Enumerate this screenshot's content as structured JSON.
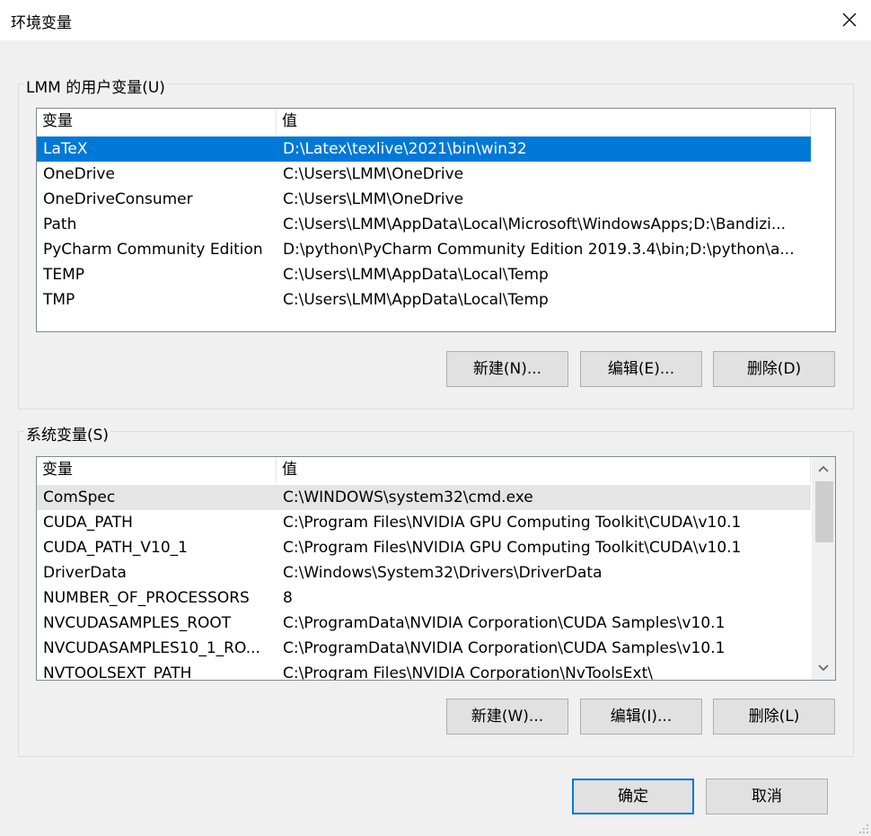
{
  "window": {
    "title": "环境变量"
  },
  "user_vars": {
    "group_label": "LMM 的用户变量(U)",
    "col_var": "变量",
    "col_val": "值",
    "rows": [
      {
        "name": "LaTeX",
        "value": "D:\\Latex\\texlive\\2021\\bin\\win32",
        "selected": true
      },
      {
        "name": "OneDrive",
        "value": "C:\\Users\\LMM\\OneDrive"
      },
      {
        "name": "OneDriveConsumer",
        "value": "C:\\Users\\LMM\\OneDrive"
      },
      {
        "name": "Path",
        "value": "C:\\Users\\LMM\\AppData\\Local\\Microsoft\\WindowsApps;D:\\Bandizi..."
      },
      {
        "name": "PyCharm Community Edition",
        "value": "D:\\python\\PyCharm Community Edition 2019.3.4\\bin;D:\\python\\a..."
      },
      {
        "name": "TEMP",
        "value": "C:\\Users\\LMM\\AppData\\Local\\Temp"
      },
      {
        "name": "TMP",
        "value": "C:\\Users\\LMM\\AppData\\Local\\Temp"
      }
    ],
    "new_label": "新建(N)...",
    "edit_label": "编辑(E)...",
    "delete_label": "删除(D)"
  },
  "system_vars": {
    "group_label": "系统变量(S)",
    "col_var": "变量",
    "col_val": "值",
    "rows": [
      {
        "name": "ComSpec",
        "value": "C:\\WINDOWS\\system32\\cmd.exe",
        "hover": true
      },
      {
        "name": "CUDA_PATH",
        "value": "C:\\Program Files\\NVIDIA GPU Computing Toolkit\\CUDA\\v10.1"
      },
      {
        "name": "CUDA_PATH_V10_1",
        "value": "C:\\Program Files\\NVIDIA GPU Computing Toolkit\\CUDA\\v10.1"
      },
      {
        "name": "DriverData",
        "value": "C:\\Windows\\System32\\Drivers\\DriverData"
      },
      {
        "name": "NUMBER_OF_PROCESSORS",
        "value": "8"
      },
      {
        "name": "NVCUDASAMPLES_ROOT",
        "value": "C:\\ProgramData\\NVIDIA Corporation\\CUDA Samples\\v10.1"
      },
      {
        "name": "NVCUDASAMPLES10_1_RO...",
        "value": "C:\\ProgramData\\NVIDIA Corporation\\CUDA Samples\\v10.1"
      },
      {
        "name": "NVTOOLSEXT_PATH",
        "value": "C:\\Program Files\\NVIDIA Corporation\\NvToolsExt\\"
      }
    ],
    "new_label": "新建(W)...",
    "edit_label": "编辑(I)...",
    "delete_label": "删除(L)"
  },
  "footer": {
    "ok_label": "确定",
    "cancel_label": "取消"
  },
  "colors": {
    "selection": "#0078d7",
    "hover": "#e5e5e5",
    "window_bg": "#f0f0f0"
  },
  "icons": [
    "close-icon",
    "scroll-up-arrow-icon",
    "scroll-down-arrow-icon",
    "size-grip-icon"
  ]
}
